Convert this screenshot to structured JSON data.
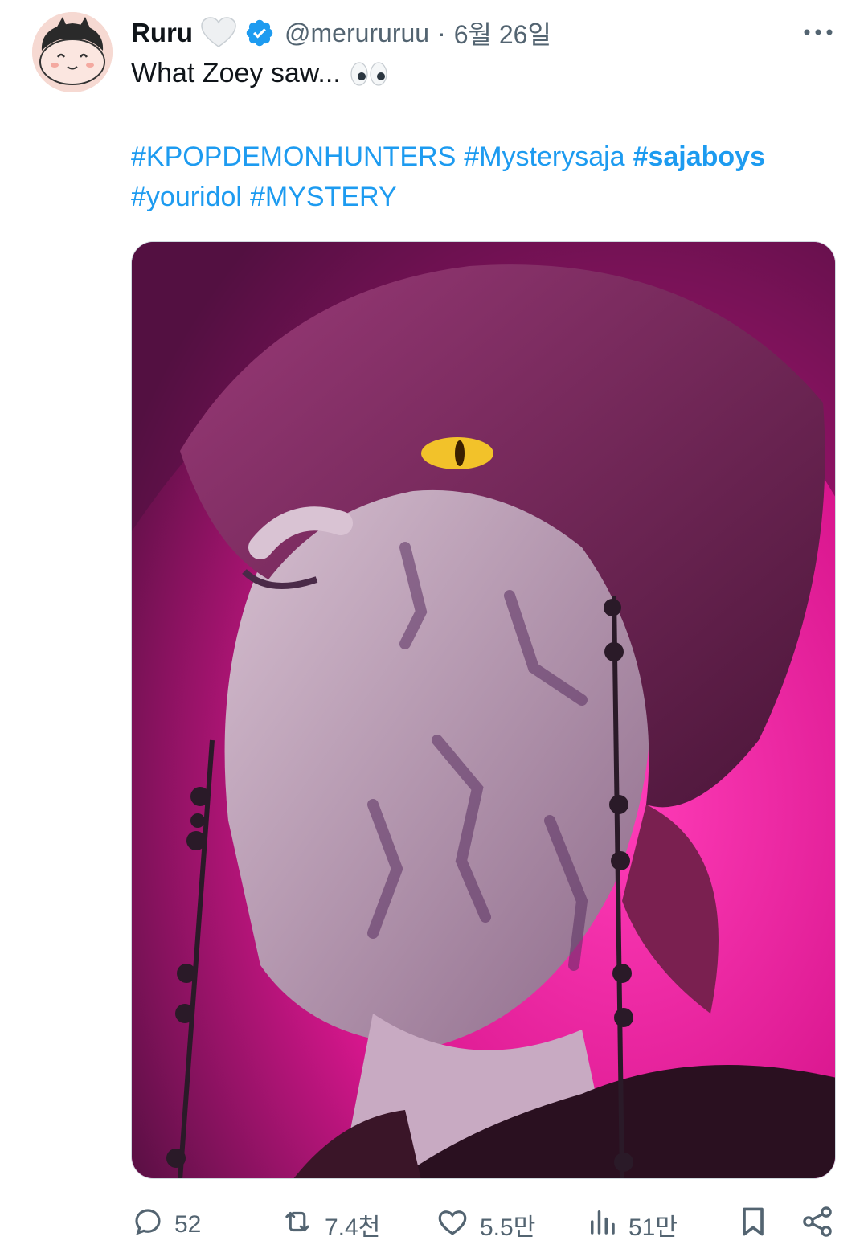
{
  "tweet": {
    "author_name": "Ruru",
    "handle": "@merururuu",
    "separator": "·",
    "date": "6월 26일",
    "text": "What Zoey saw...",
    "hashtags": [
      {
        "text": "#KPOPDEMONHUNTERS",
        "bold": false
      },
      {
        "text": "#Mysterysaja",
        "bold": false
      },
      {
        "text": "#sajaboys",
        "bold": true
      },
      {
        "text": "#youridol",
        "bold": false
      },
      {
        "text": "#MYSTERY",
        "bold": false
      }
    ]
  },
  "actions": {
    "reply_count": "52",
    "retweet_count": "7.4천",
    "like_count": "5.5만",
    "view_count": "51만"
  },
  "icons": [
    "avatar",
    "white-heart-icon",
    "verified-badge-icon",
    "more-options-icon",
    "eyes-emoji-icon",
    "reply-icon",
    "retweet-icon",
    "like-icon",
    "views-icon",
    "bookmark-icon",
    "share-icon"
  ],
  "colors": {
    "link": "#1d9bf0",
    "muted": "#536471",
    "text": "#0f1419",
    "verified": "#1d9bf0",
    "media_accent": "#ff2fb0"
  }
}
